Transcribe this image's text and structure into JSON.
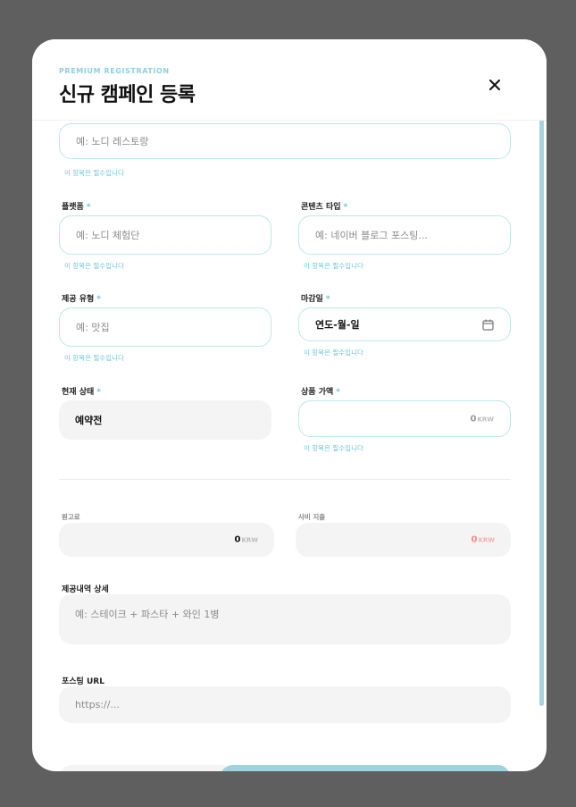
{
  "header": {
    "eyebrow": "PREMIUM REGISTRATION",
    "title": "신규 캠페인 등록"
  },
  "required_hint": "이 항목은 필수입니다",
  "fields": {
    "campaign_name": {
      "placeholder": "예: 노디 레스토랑"
    },
    "platform": {
      "label": "플랫폼",
      "placeholder": "예: 노디 체험단"
    },
    "content_type": {
      "label": "콘텐츠 타입",
      "placeholder": "예: 네이버 블로그 포스팅..."
    },
    "offer_type": {
      "label": "제공 유형",
      "placeholder": "예: 맛집"
    },
    "deadline": {
      "label": "마감일",
      "value": "연도-월-일"
    },
    "status": {
      "label": "현재 상태",
      "value": "예약전"
    },
    "product_price": {
      "label": "상품 가액",
      "value": "0",
      "unit": "KRW"
    },
    "fee": {
      "label": "원고료",
      "value": "0",
      "unit": "KRW"
    },
    "own_expense": {
      "label": "사비 지출",
      "value": "0",
      "unit": "KRW"
    },
    "offer_detail": {
      "label": "제공내역 상세",
      "placeholder": "예: 스테이크 + 파스타 + 와인 1병"
    },
    "posting_url": {
      "label": "포스팅 URL",
      "placeholder": "https://..."
    }
  },
  "required_mark": "*",
  "colors": {
    "accent": "#6cc7d8",
    "border": "#bfe8ea",
    "expense": "#f08a8a",
    "gray_fill": "#f4f4f4"
  },
  "icons": {
    "close": "close-icon",
    "calendar": "calendar-icon"
  }
}
